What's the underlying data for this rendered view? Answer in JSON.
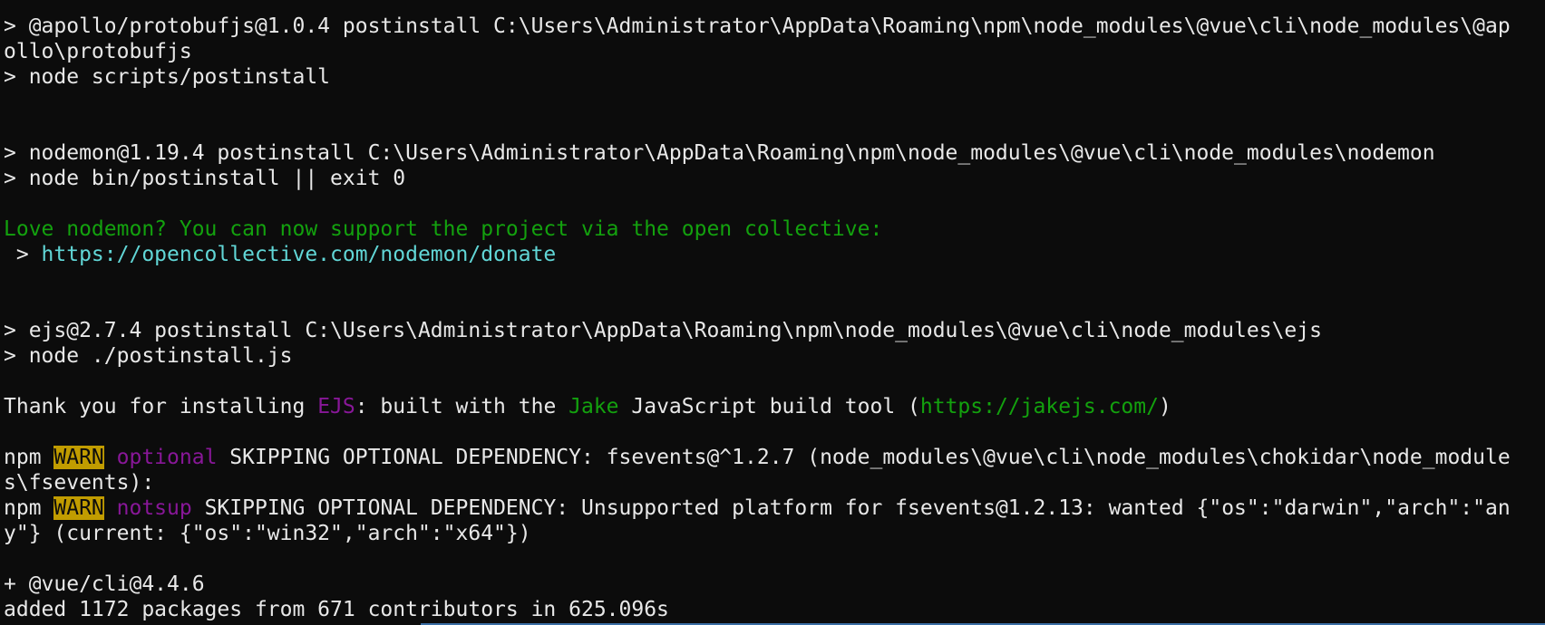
{
  "terminal": {
    "lines": [
      {
        "id": "apollo-1",
        "parts": [
          {
            "t": "> @apollo/protobufjs@1.0.4 postinstall C:\\Users\\Administrator\\AppData\\Roaming\\npm\\node_modules\\@vue\\cli\\node_modules\\@ap"
          }
        ]
      },
      {
        "id": "apollo-2",
        "parts": [
          {
            "t": "ollo\\protobufjs"
          }
        ]
      },
      {
        "id": "apollo-3",
        "parts": [
          {
            "t": "> node scripts/postinstall"
          }
        ]
      },
      {
        "id": "blank-1",
        "parts": []
      },
      {
        "id": "blank-2",
        "parts": []
      },
      {
        "id": "nodemon-1",
        "parts": [
          {
            "t": "> nodemon@1.19.4 postinstall C:\\Users\\Administrator\\AppData\\Roaming\\npm\\node_modules\\@vue\\cli\\node_modules\\nodemon"
          }
        ]
      },
      {
        "id": "nodemon-2",
        "parts": [
          {
            "t": "> node bin/postinstall || exit 0"
          }
        ]
      },
      {
        "id": "blank-3",
        "parts": []
      },
      {
        "id": "nodemon-3",
        "parts": [
          {
            "t": "Love nodemon? You can now support the project via the open collective:",
            "c": "green"
          }
        ]
      },
      {
        "id": "nodemon-4",
        "parts": [
          {
            "t": " > "
          },
          {
            "t": "https://opencollective.com/nodemon/donate",
            "c": "cyan"
          }
        ]
      },
      {
        "id": "blank-4",
        "parts": []
      },
      {
        "id": "blank-5",
        "parts": []
      },
      {
        "id": "ejs-1",
        "parts": [
          {
            "t": "> ejs@2.7.4 postinstall C:\\Users\\Administrator\\AppData\\Roaming\\npm\\node_modules\\@vue\\cli\\node_modules\\ejs"
          }
        ]
      },
      {
        "id": "ejs-2",
        "parts": [
          {
            "t": "> node ./postinstall.js"
          }
        ]
      },
      {
        "id": "blank-6",
        "parts": []
      },
      {
        "id": "ejs-3",
        "parts": [
          {
            "t": "Thank you for installing "
          },
          {
            "t": "EJS",
            "c": "magenta"
          },
          {
            "t": ": built with the "
          },
          {
            "t": "Jake",
            "c": "green"
          },
          {
            "t": " JavaScript build tool ("
          },
          {
            "t": "https://jakejs.com/",
            "c": "green"
          },
          {
            "t": ")"
          }
        ]
      },
      {
        "id": "blank-7",
        "parts": []
      },
      {
        "id": "warn-1",
        "parts": [
          {
            "t": "npm "
          },
          {
            "t": "WARN",
            "c": "warn"
          },
          {
            "t": " "
          },
          {
            "t": "optional",
            "c": "magenta"
          },
          {
            "t": " SKIPPING OPTIONAL DEPENDENCY: fsevents@^1.2.7 (node_modules\\@vue\\cli\\node_modules\\chokidar\\node_module"
          }
        ]
      },
      {
        "id": "warn-2",
        "parts": [
          {
            "t": "s\\fsevents):"
          }
        ]
      },
      {
        "id": "warn-3",
        "parts": [
          {
            "t": "npm "
          },
          {
            "t": "WARN",
            "c": "warn"
          },
          {
            "t": " "
          },
          {
            "t": "notsup",
            "c": "magenta"
          },
          {
            "t": " SKIPPING OPTIONAL DEPENDENCY: Unsupported platform for fsevents@1.2.13: wanted {\"os\":\"darwin\",\"arch\":\"an"
          }
        ]
      },
      {
        "id": "warn-4",
        "parts": [
          {
            "t": "y\"} (current: {\"os\":\"win32\",\"arch\":\"x64\"})"
          }
        ]
      },
      {
        "id": "blank-8",
        "parts": []
      },
      {
        "id": "result-1",
        "parts": [
          {
            "t": "+ @vue/cli@4.4.6"
          }
        ]
      },
      {
        "id": "result-2",
        "parts": [
          {
            "t": "added 1172 packages from 671 contributors in 625.096s"
          }
        ]
      }
    ]
  },
  "colors": {
    "background": "#0c0c0c",
    "foreground": "#e8e8e8",
    "green": "#13a10e",
    "cyan": "#61d6d6",
    "magenta": "#881798",
    "warn_bg": "#c19c00"
  }
}
